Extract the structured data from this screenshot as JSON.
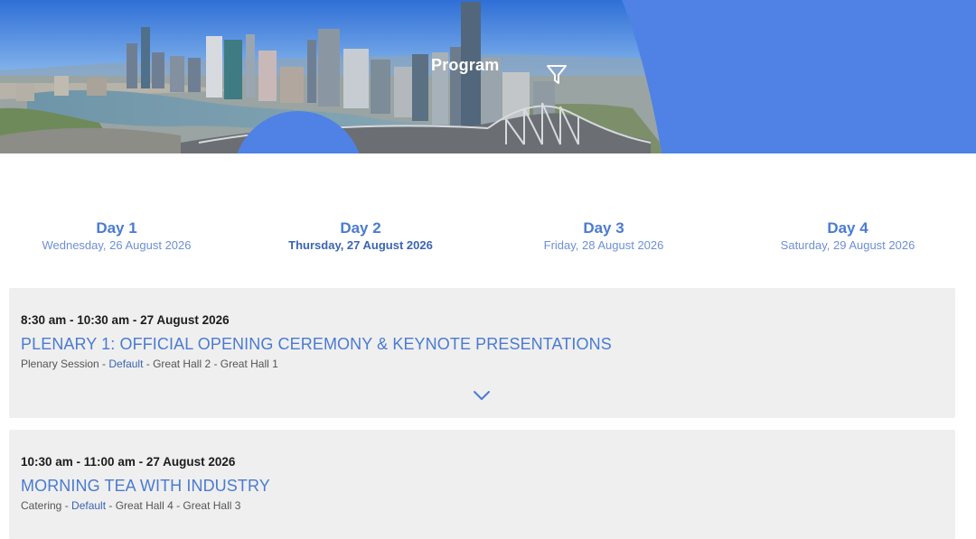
{
  "hero": {
    "title": "Program",
    "filter_icon": "filter-icon",
    "accent_color": "#4f82e4"
  },
  "days": [
    {
      "label": "Day 1",
      "date": "Wednesday, 26 August 2026",
      "active": false
    },
    {
      "label": "Day 2",
      "date": "Thursday, 27 August 2026",
      "active": true
    },
    {
      "label": "Day 3",
      "date": "Friday, 28 August 2026",
      "active": false
    },
    {
      "label": "Day 4",
      "date": "Saturday, 29 August 2026",
      "active": false
    }
  ],
  "sessions": [
    {
      "time": "8:30 am - 10:30 am - 27 August 2026",
      "title": "PLENARY 1: OFFICIAL OPENING CEREMONY & KEYNOTE PRESENTATIONS",
      "type": "Plenary Session",
      "sep1": " - ",
      "stream": "Default",
      "rooms": " - Great Hall 2 - Great Hall 1",
      "expand_icon": "chevron-down-icon"
    },
    {
      "time": "10:30 am - 11:00 am - 27 August 2026",
      "title": "MORNING TEA WITH INDUSTRY",
      "type": "Catering",
      "sep1": " - ",
      "stream": "Default",
      "rooms": " - Great Hall 4 - Great Hall 3"
    }
  ],
  "colors": {
    "link_blue": "#4a7bd1",
    "card_bg": "#efefef"
  }
}
